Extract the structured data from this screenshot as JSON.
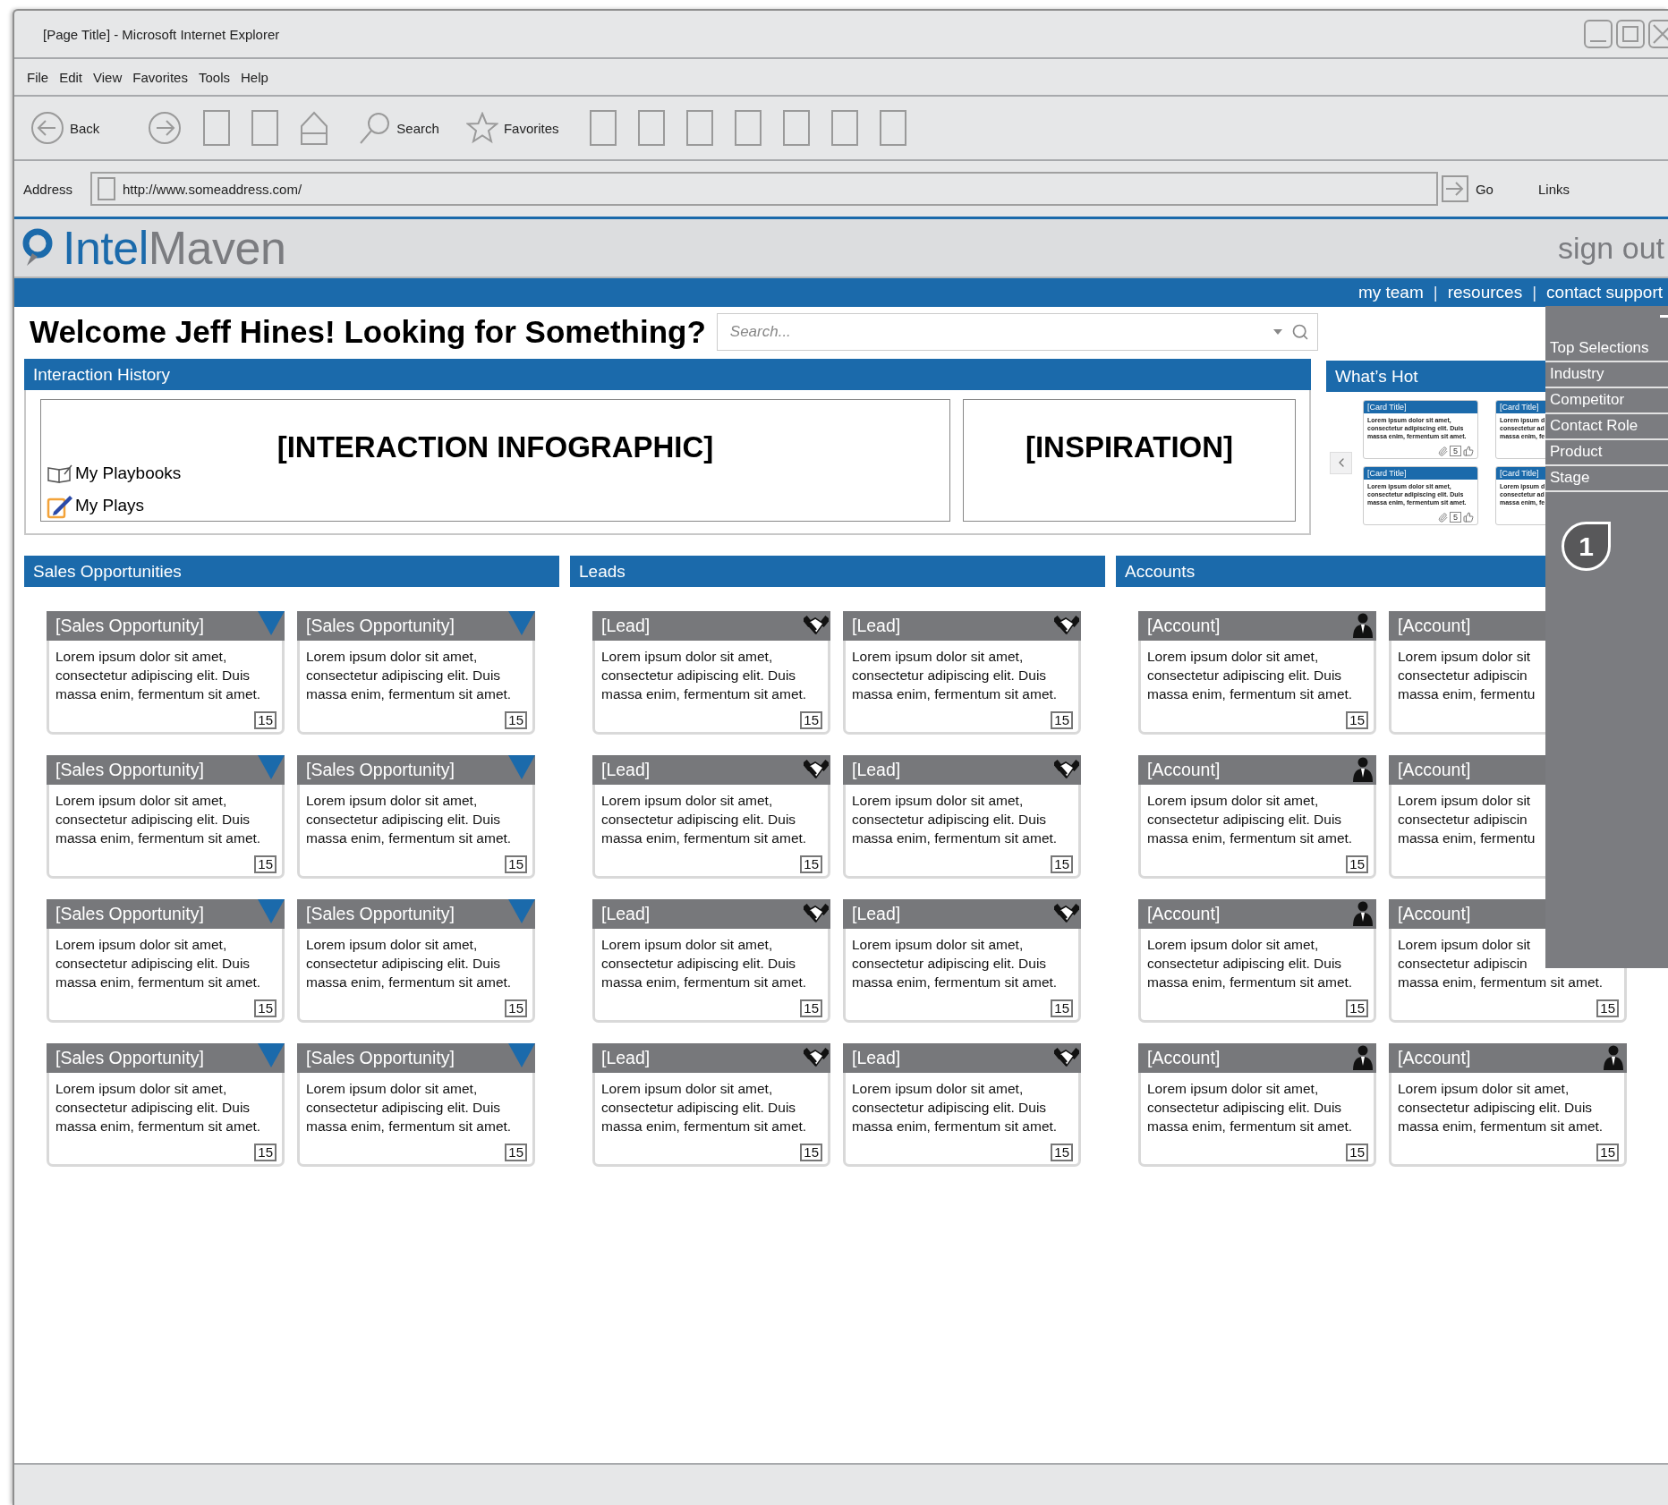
{
  "browser": {
    "title": "[Page Title] - Microsoft Internet Explorer",
    "menu": [
      "File",
      "Edit",
      "View",
      "Favorites",
      "Tools",
      "Help"
    ],
    "toolbar": [
      {
        "kind": "back",
        "label": "Back"
      },
      {
        "kind": "forward"
      },
      {
        "kind": "blank"
      },
      {
        "kind": "blank"
      },
      {
        "kind": "home"
      },
      {
        "kind": "search",
        "label": "Search"
      },
      {
        "kind": "favorites",
        "label": "Favorites"
      },
      {
        "kind": "blank"
      },
      {
        "kind": "blank"
      },
      {
        "kind": "blank"
      },
      {
        "kind": "blank"
      },
      {
        "kind": "blank"
      },
      {
        "kind": "blank"
      },
      {
        "kind": "blank"
      }
    ],
    "address_label": "Address",
    "url": "http://www.someaddress.com/",
    "go": "Go",
    "links": "Links"
  },
  "app": {
    "brand_first": "Intel",
    "brand_second": "Maven",
    "sign_out": "sign out",
    "nav": [
      {
        "kind": "link",
        "label": "my team"
      },
      {
        "kind": "separator",
        "label": "|"
      },
      {
        "kind": "link",
        "label": "resources"
      },
      {
        "kind": "separator",
        "label": "|"
      },
      {
        "kind": "link",
        "label": "contact support"
      }
    ],
    "welcome": "Welcome Jeff Hines! Looking for Something?",
    "search": {
      "placeholder": "Search..."
    },
    "interaction_history": {
      "title": "Interaction History",
      "infographic": "[INTERACTION INFOGRAPHIC]",
      "inspiration": "[INSPIRATION]",
      "links": [
        {
          "kind": "playbooks",
          "label": "My Playbooks"
        },
        {
          "kind": "plays",
          "label": "My Plays"
        }
      ]
    },
    "whats_hot": {
      "title": "What’s Hot",
      "cards": [
        {
          "title": "[Card Title]",
          "lines": [
            "Lorem ipsum dolor sit amet,",
            "consectetur adipiscing elit. Duis",
            "massa enim, fermentum sit amet."
          ],
          "comments": "5"
        },
        {
          "title": "[Card Title]",
          "lines": [
            "Lorem ipsum d",
            "consectetur ad",
            "massa enim, fe"
          ]
        },
        {
          "title": "[Card Title]",
          "lines": [
            "Lorem ipsum dolor sit amet,",
            "consectetur adipiscing elit. Duis",
            "massa enim, fermentum sit amet."
          ],
          "comments": "5"
        },
        {
          "title": "[Card Title]",
          "lines": [
            "Lorem ipsum d",
            "consectetur ad",
            "massa enim, fe"
          ]
        }
      ]
    },
    "sections": [
      {
        "title": "Sales Opportunities",
        "kind": "opportunity",
        "cards": [
          {
            "title": "[Sales Opportunity]",
            "lines": [
              "Lorem ipsum dolor sit amet,",
              "consectetur adipiscing elit. Duis",
              "massa enim, fermentum sit amet."
            ],
            "icon": true,
            "count": "15"
          },
          {
            "title": "[Sales Opportunity]",
            "lines": [
              "Lorem ipsum dolor sit amet,",
              "consectetur adipiscing elit. Duis",
              "massa enim, fermentum sit amet."
            ],
            "icon": true,
            "count": "15"
          },
          {
            "title": "[Sales Opportunity]",
            "lines": [
              "Lorem ipsum dolor sit amet,",
              "consectetur adipiscing elit. Duis",
              "massa enim, fermentum sit amet."
            ],
            "icon": true,
            "count": "15"
          },
          {
            "title": "[Sales Opportunity]",
            "lines": [
              "Lorem ipsum dolor sit amet,",
              "consectetur adipiscing elit. Duis",
              "massa enim, fermentum sit amet."
            ],
            "icon": true,
            "count": "15"
          },
          {
            "title": "[Sales Opportunity]",
            "lines": [
              "Lorem ipsum dolor sit amet,",
              "consectetur adipiscing elit. Duis",
              "massa enim, fermentum sit amet."
            ],
            "icon": true,
            "count": "15"
          },
          {
            "title": "[Sales Opportunity]",
            "lines": [
              "Lorem ipsum dolor sit amet,",
              "consectetur adipiscing elit. Duis",
              "massa enim, fermentum sit amet."
            ],
            "icon": true,
            "count": "15"
          },
          {
            "title": "[Sales Opportunity]",
            "lines": [
              "Lorem ipsum dolor sit amet,",
              "consectetur adipiscing elit. Duis",
              "massa enim, fermentum sit amet."
            ],
            "icon": true,
            "count": "15"
          },
          {
            "title": "[Sales Opportunity]",
            "lines": [
              "Lorem ipsum dolor sit amet,",
              "consectetur adipiscing elit. Duis",
              "massa enim, fermentum sit amet."
            ],
            "icon": true,
            "count": "15"
          }
        ]
      },
      {
        "title": "Leads",
        "kind": "lead",
        "cards": [
          {
            "title": "[Lead]",
            "lines": [
              "Lorem ipsum dolor sit amet,",
              "consectetur adipiscing elit. Duis",
              "massa enim, fermentum sit amet."
            ],
            "icon": true,
            "count": "15"
          },
          {
            "title": "[Lead]",
            "lines": [
              "Lorem ipsum dolor sit amet,",
              "consectetur adipiscing elit. Duis",
              "massa enim, fermentum sit amet."
            ],
            "icon": true,
            "count": "15"
          },
          {
            "title": "[Lead]",
            "lines": [
              "Lorem ipsum dolor sit amet,",
              "consectetur adipiscing elit. Duis",
              "massa enim, fermentum sit amet."
            ],
            "icon": true,
            "count": "15"
          },
          {
            "title": "[Lead]",
            "lines": [
              "Lorem ipsum dolor sit amet,",
              "consectetur adipiscing elit. Duis",
              "massa enim, fermentum sit amet."
            ],
            "icon": true,
            "count": "15"
          },
          {
            "title": "[Lead]",
            "lines": [
              "Lorem ipsum dolor sit amet,",
              "consectetur adipiscing elit. Duis",
              "massa enim, fermentum sit amet."
            ],
            "icon": true,
            "count": "15"
          },
          {
            "title": "[Lead]",
            "lines": [
              "Lorem ipsum dolor sit amet,",
              "consectetur adipiscing elit. Duis",
              "massa enim, fermentum sit amet."
            ],
            "icon": true,
            "count": "15"
          },
          {
            "title": "[Lead]",
            "lines": [
              "Lorem ipsum dolor sit amet,",
              "consectetur adipiscing elit. Duis",
              "massa enim, fermentum sit amet."
            ],
            "icon": true,
            "count": "15"
          },
          {
            "title": "[Lead]",
            "lines": [
              "Lorem ipsum dolor sit amet,",
              "consectetur adipiscing elit. Duis",
              "massa enim, fermentum sit amet."
            ],
            "icon": true,
            "count": "15"
          }
        ]
      },
      {
        "title": "Accounts",
        "kind": "account",
        "cards": [
          {
            "title": "[Account]",
            "lines": [
              "Lorem ipsum dolor sit amet,",
              "consectetur adipiscing elit. Duis",
              "massa enim, fermentum sit amet."
            ],
            "icon": true,
            "count": "15"
          },
          {
            "title": "[Account]",
            "lines": [
              "Lorem ipsum dolor sit",
              "consectetur adipiscin",
              "massa enim, fermentu"
            ],
            "icon": false
          },
          {
            "title": "[Account]",
            "lines": [
              "Lorem ipsum dolor sit amet,",
              "consectetur adipiscing elit. Duis",
              "massa enim, fermentum sit amet."
            ],
            "icon": true,
            "count": "15"
          },
          {
            "title": "[Account]",
            "lines": [
              "Lorem ipsum dolor sit",
              "consectetur adipiscin",
              "massa enim, fermentu"
            ],
            "icon": false
          },
          {
            "title": "[Account]",
            "lines": [
              "Lorem ipsum dolor sit amet,",
              "consectetur adipiscing elit. Duis",
              "massa enim, fermentum sit amet."
            ],
            "icon": true,
            "count": "15"
          },
          {
            "title": "[Account]",
            "lines": [
              "Lorem ipsum dolor sit",
              "consectetur adipiscin",
              "massa enim, fermentum sit amet."
            ],
            "icon": false,
            "count": "15"
          },
          {
            "title": "[Account]",
            "lines": [
              "Lorem ipsum dolor sit amet,",
              "consectetur adipiscing elit. Duis",
              "massa enim, fermentum sit amet."
            ],
            "icon": true,
            "count": "15"
          },
          {
            "title": "[Account]",
            "lines": [
              "Lorem ipsum dolor sit amet,",
              "consectetur adipiscing elit. Duis",
              "massa enim, fermentum sit amet."
            ],
            "icon": true,
            "count": "15"
          }
        ]
      }
    ],
    "filter_panel": {
      "items": [
        "Top Selections",
        "Industry",
        "Competitor",
        "Contact Role",
        "Product",
        "Stage"
      ],
      "badge": "1"
    }
  }
}
